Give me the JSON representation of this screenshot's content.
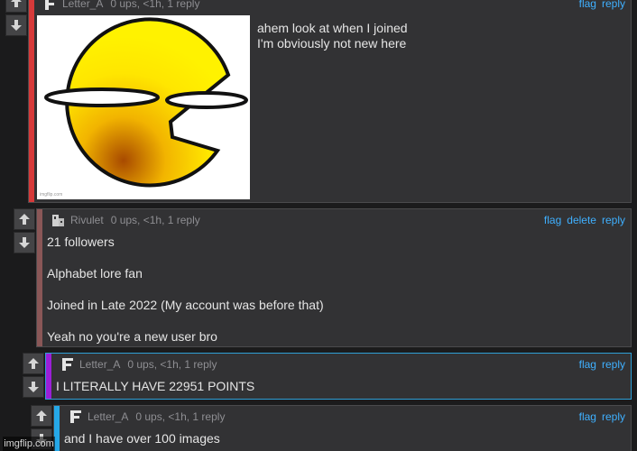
{
  "colors": {
    "comment_1_stripe": "#d63a3a",
    "comment_2_stripe": "#8a5757",
    "comment_3_stripe": "#9b1fd8",
    "comment_4_stripe": "#25a8e8",
    "link": "#3fb0ff"
  },
  "comments": [
    {
      "username": "Letter_A",
      "meta": "0 ups, <1h, 1 reply",
      "actions": [
        "flag",
        "reply"
      ],
      "lines": [
        "ahem look at when I joined",
        "I'm obviously not new here"
      ],
      "image_watermark": "imgflip.com"
    },
    {
      "username": "Rivulet",
      "meta": "0 ups, <1h, 1 reply",
      "actions": [
        "flag",
        "delete",
        "reply"
      ],
      "lines": [
        "21 followers",
        "Alphabet lore fan",
        "Joined in Late 2022 (My account was before that)",
        "Yeah no you're a new user bro"
      ]
    },
    {
      "username": "Letter_A",
      "meta": "0 ups, <1h, 1 reply",
      "actions": [
        "flag",
        "reply"
      ],
      "lines": [
        "I LITERALLY HAVE 22951 POINTS"
      ]
    },
    {
      "username": "Letter_A",
      "meta": "0 ups, <1h, 1 reply",
      "actions": [
        "flag",
        "reply"
      ],
      "lines": [
        "and I have over 100 images"
      ]
    }
  ],
  "footer": {
    "watermark": "imgflip.com"
  },
  "icons": {
    "upvote": "arrow-up-icon",
    "downvote": "arrow-down-icon"
  }
}
